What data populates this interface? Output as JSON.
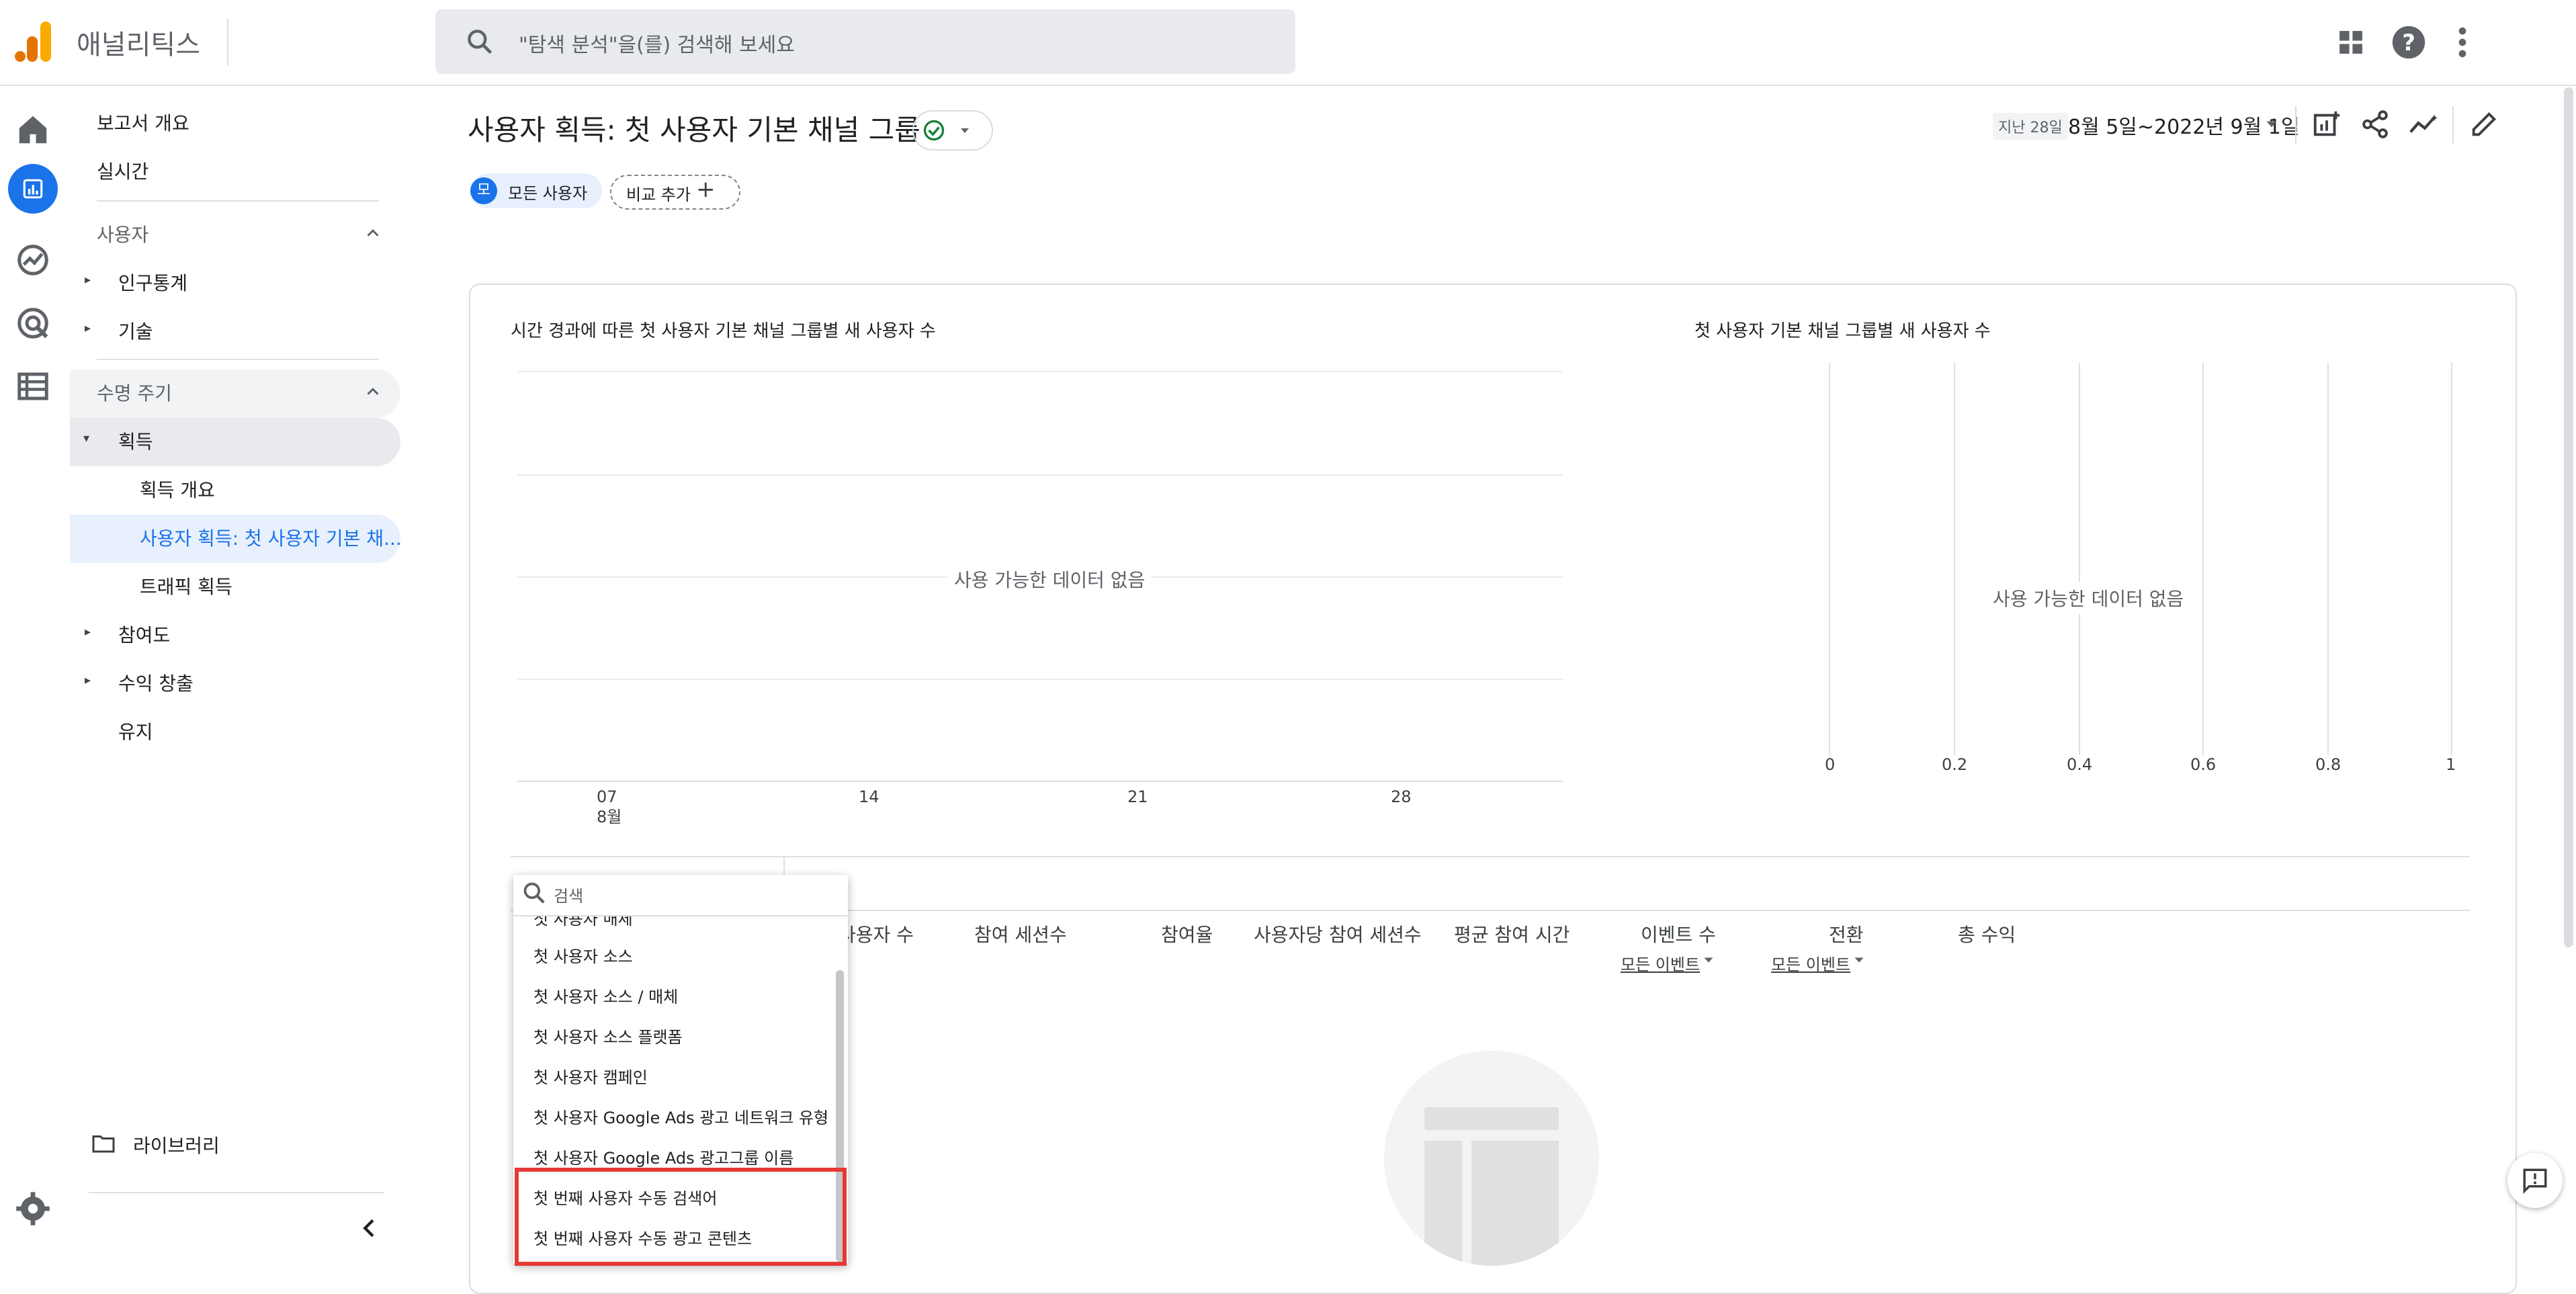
{
  "app": {
    "brand": "애널리틱스"
  },
  "search": {
    "placeholder": "\"탐색 분석\"을(를) 검색해 보세요"
  },
  "sidebar": {
    "overview": "보고서 개요",
    "realtime": "실시간",
    "section_user": "사용자",
    "demographics": "인구통계",
    "tech": "기술",
    "section_lifecycle": "수명 주기",
    "acquisition": "획득",
    "acq_overview": "획득 개요",
    "acq_user": "사용자 획득: 첫 사용자 기본 채...",
    "acq_traffic": "트래픽 획득",
    "engagement": "참여도",
    "monetization": "수익 창출",
    "retention": "유지",
    "library": "라이브러리"
  },
  "header": {
    "title": "사용자 획득: 첫 사용자 기본 채널 그룹",
    "segment_badge": "모",
    "segment_label": "모든 사용자",
    "compare_label": "비교 추가",
    "date_prefix": "지난 28일",
    "date_range": "8월 5일~2022년 9월 1일"
  },
  "line_chart": {
    "title": "시간 경과에 따른 첫 사용자 기본 채널 그룹별 새 사용자 수",
    "no_data": "사용 가능한 데이터 없음",
    "x_ticks": [
      "07",
      "14",
      "21",
      "28"
    ],
    "x_month": "8월"
  },
  "bar_chart": {
    "title": "첫 사용자 기본 채널 그룹별 새 사용자 수",
    "no_data": "사용 가능한 데이터 없음",
    "x_ticks": [
      "0",
      "0.2",
      "0.4",
      "0.6",
      "0.8",
      "1"
    ]
  },
  "table": {
    "columns": [
      "사용자 수",
      "참여 세션수",
      "참여율",
      "사용자당 참여 세션수",
      "평균 참여 시간",
      "이벤트 수",
      "전환",
      "총 수익"
    ],
    "event_filter": "모든 이벤트",
    "conversion_filter": "모든 이벤트"
  },
  "dropdown": {
    "search_placeholder": "검색",
    "partial_item": "첫 사용자 매체",
    "items": [
      "첫 사용자 소스",
      "첫 사용자 소스 / 매체",
      "첫 사용자 소스 플랫폼",
      "첫 사용자 캠페인",
      "첫 사용자 Google Ads 광고 네트워크 유형",
      "첫 사용자 Google Ads 광고그룹 이름",
      "첫 번째 사용자 수동 검색어",
      "첫 번째 사용자 수동 광고 콘텐츠"
    ]
  },
  "colors": {
    "accent": "#1a73e8",
    "selected_bg": "#e8f0fe",
    "highlight": "#e53935",
    "logo_orange": "#f9ab00",
    "logo_dark": "#e37400"
  }
}
